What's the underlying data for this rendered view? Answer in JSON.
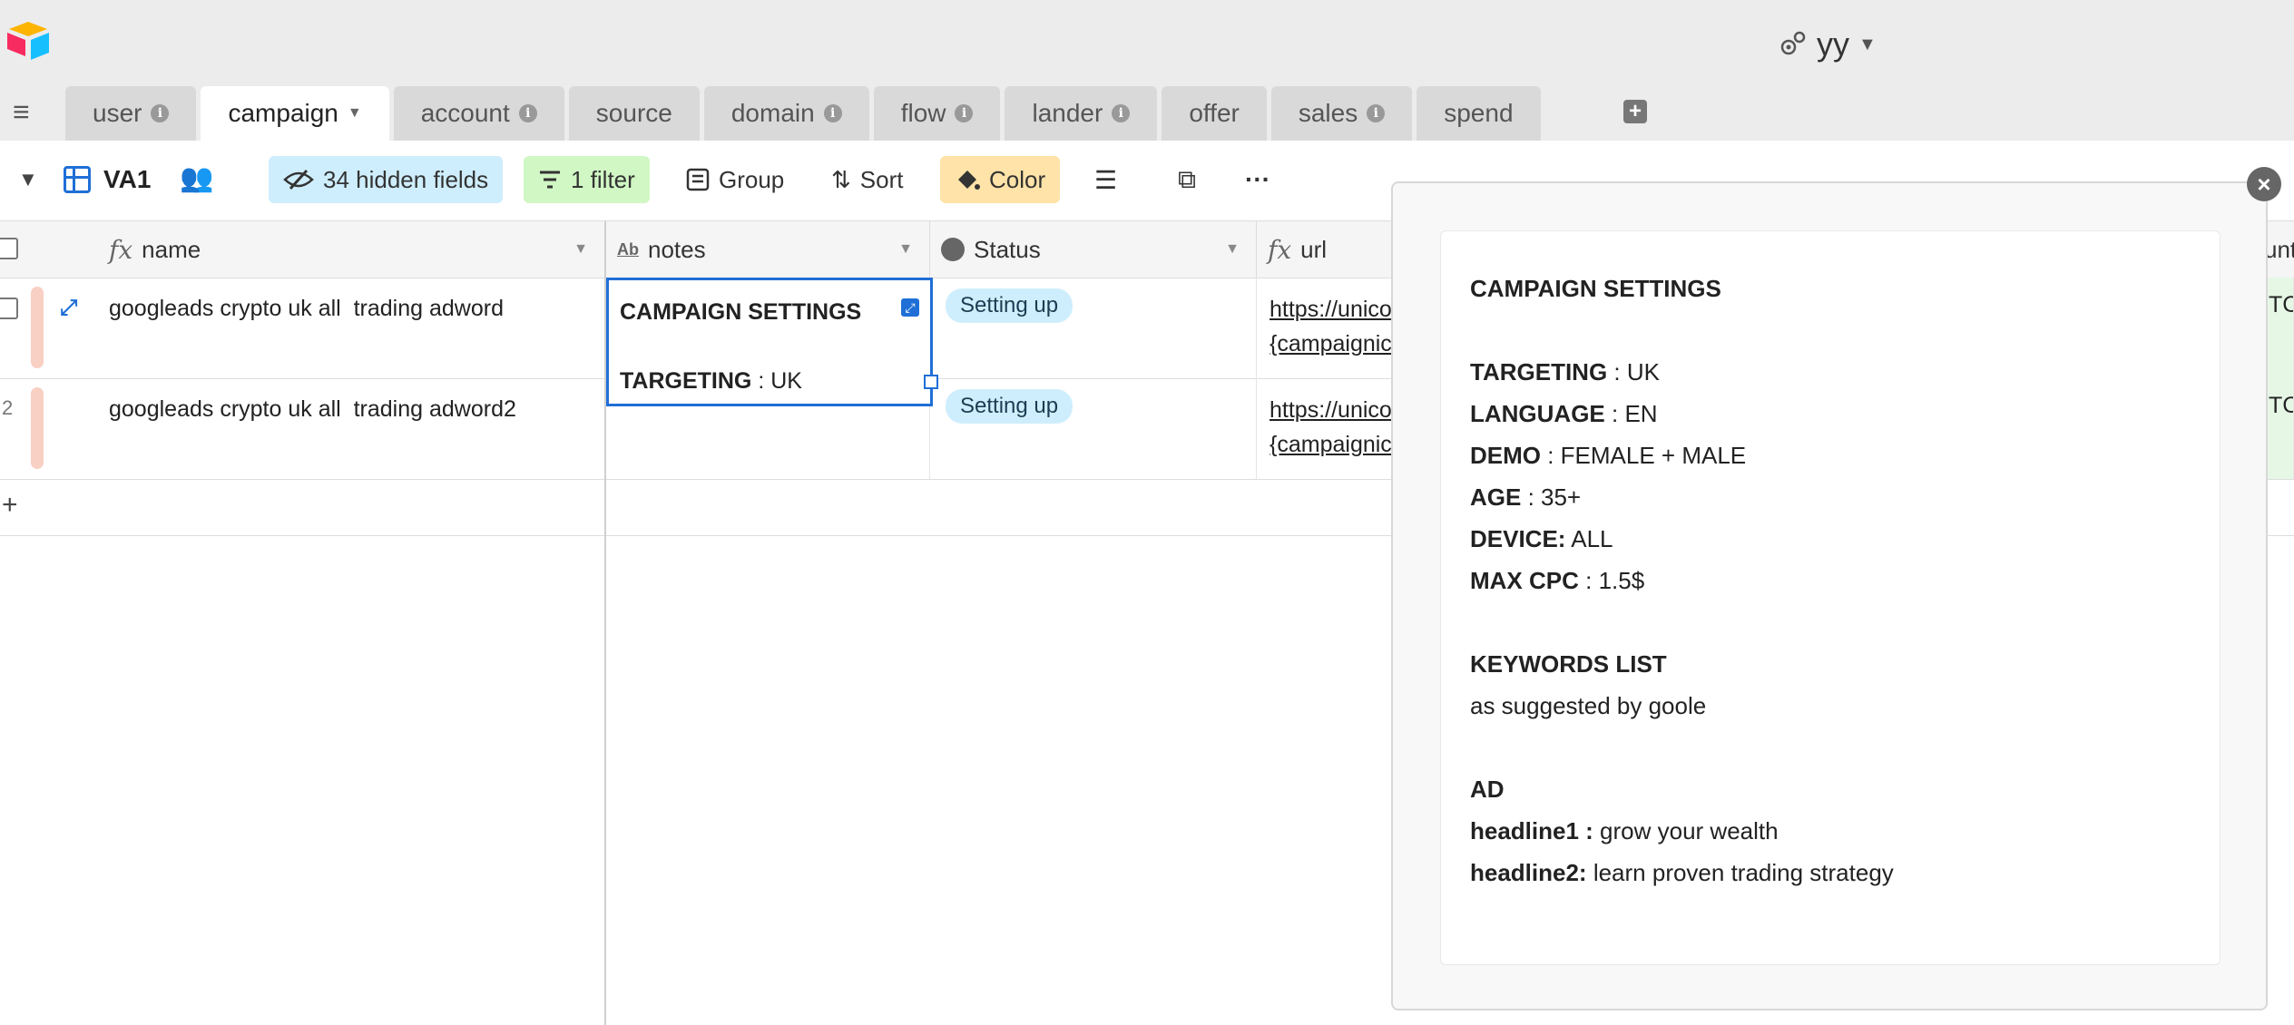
{
  "header": {
    "account": "yy"
  },
  "tabs": [
    {
      "label": "user",
      "info": true
    },
    {
      "label": "campaign",
      "active": true
    },
    {
      "label": "account",
      "info": true
    },
    {
      "label": "source"
    },
    {
      "label": "domain",
      "info": true
    },
    {
      "label": "flow",
      "info": true
    },
    {
      "label": "lander",
      "info": true
    },
    {
      "label": "offer"
    },
    {
      "label": "sales",
      "info": true
    },
    {
      "label": "spend"
    }
  ],
  "toolbar": {
    "view_name": "VA1",
    "hidden_fields": "34 hidden fields",
    "filter": "1 filter",
    "group": "Group",
    "sort": "Sort",
    "color": "Color"
  },
  "columns": {
    "name": "name",
    "notes": "notes",
    "status": "Status",
    "url": "url",
    "next": "unt"
  },
  "rows": [
    {
      "num": "",
      "name": "googleads crypto uk all  trading adword",
      "notes_title": "CAMPAIGN SETTINGS",
      "notes_target_label": "TARGETING",
      "notes_target_value": " : UK",
      "status": "Setting up",
      "url_1": "https://unico",
      "url_2": "{campaignic",
      "extra": "TC"
    },
    {
      "num": "2",
      "name": "googleads crypto uk all  trading adword2",
      "status": "Setting up",
      "url_1": "https://unico",
      "url_2": "{campaignic",
      "extra": "TC"
    }
  ],
  "add_row": "+",
  "popup": {
    "title": "CAMPAIGN SETTINGS",
    "targeting_label": "TARGETING",
    "targeting_value": " : UK",
    "language_label": "LANGUAGE",
    "language_value": " : EN",
    "demo_label": "DEMO",
    "demo_value": " : FEMALE + MALE",
    "age_label": "AGE",
    "age_value": " : 35+",
    "device_label": "DEVICE:",
    "device_value": " ALL",
    "maxcpc_label": "MAX CPC",
    "maxcpc_value": " : 1.5$",
    "keywords_title": "KEYWORDS LIST",
    "keywords_value": "as suggested by goole",
    "ad_title": "AD",
    "headline1_label": "headline1 :",
    "headline1_value": " grow your wealth",
    "headline2_label": "headline2:",
    "headline2_value": " learn proven trading strategy"
  },
  "colors": {
    "accent": "#1f6fd6",
    "hidden_bg": "#cfeefd",
    "filter_bg": "#d1f7c4",
    "color_bg": "#ffe3a8",
    "status_pill": "#cfeefd"
  }
}
